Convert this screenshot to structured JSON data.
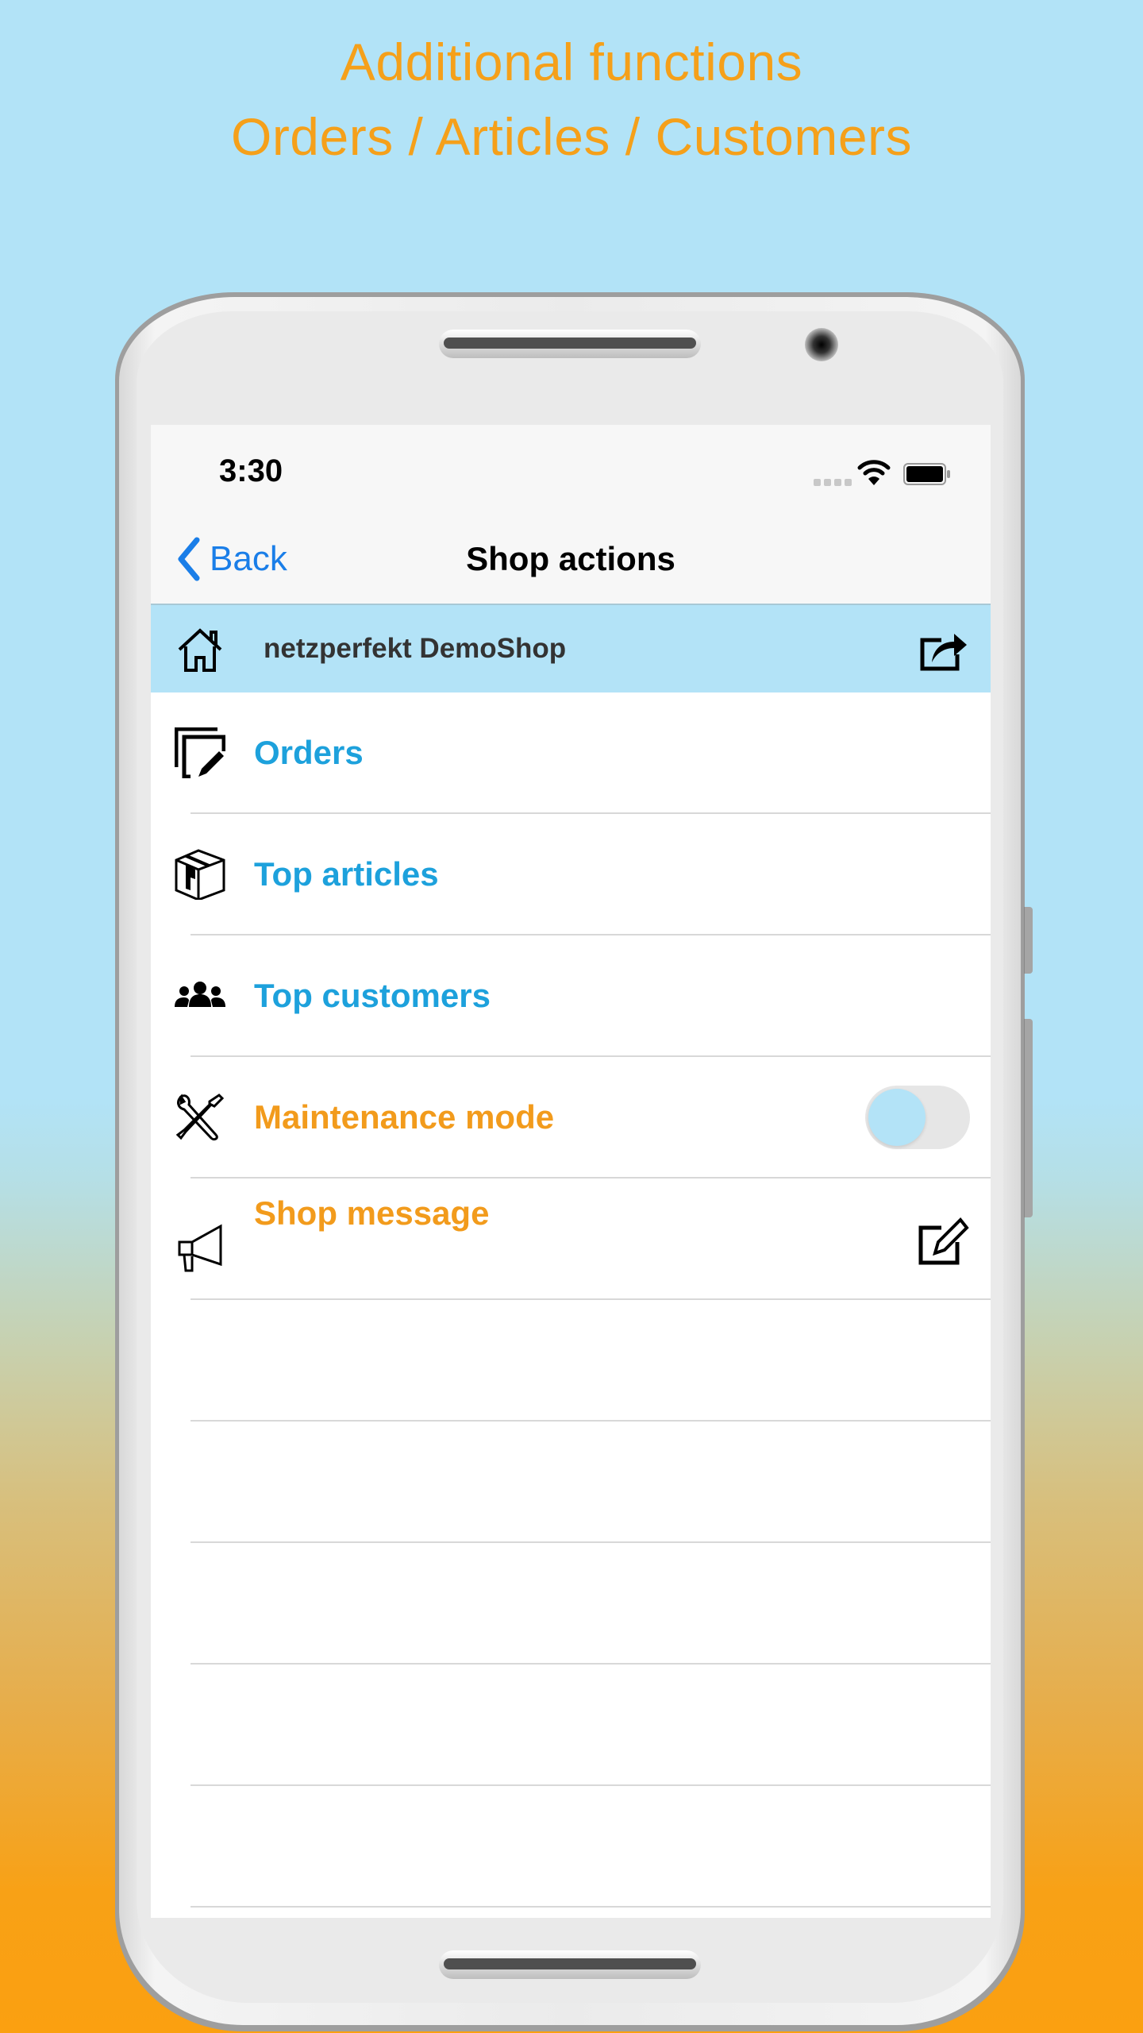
{
  "promo": {
    "line1": "Additional functions",
    "line2": "Orders / Articles / Customers"
  },
  "status_bar": {
    "time": "3:30",
    "icons": [
      "signal-icon",
      "wifi-icon",
      "battery-icon"
    ]
  },
  "nav": {
    "back_label": "Back",
    "title": "Shop actions"
  },
  "shop_header": {
    "shop_name": "netzperfekt DemoShop",
    "left_icon": "home-icon",
    "right_icon": "share-icon"
  },
  "menu": [
    {
      "label": "Orders",
      "icon": "orders-edit-icon",
      "color": "#1da1dc"
    },
    {
      "label": "Top articles",
      "icon": "package-box-icon",
      "color": "#1da1dc"
    },
    {
      "label": "Top customers",
      "icon": "users-group-icon",
      "color": "#1da1dc"
    },
    {
      "label": "Maintenance mode",
      "icon": "tools-icon",
      "color": "#f29b1c",
      "toggle_on": false
    },
    {
      "label": "Shop message",
      "icon": "megaphone-icon",
      "color": "#f29b1c",
      "action_icon": "edit-icon"
    }
  ],
  "colors": {
    "accent_blue": "#1da1dc",
    "accent_orange": "#f29b1c",
    "header_bg": "#b3e3f7",
    "ios_link": "#1a7ee8",
    "promo_text": "#f5a01a"
  }
}
